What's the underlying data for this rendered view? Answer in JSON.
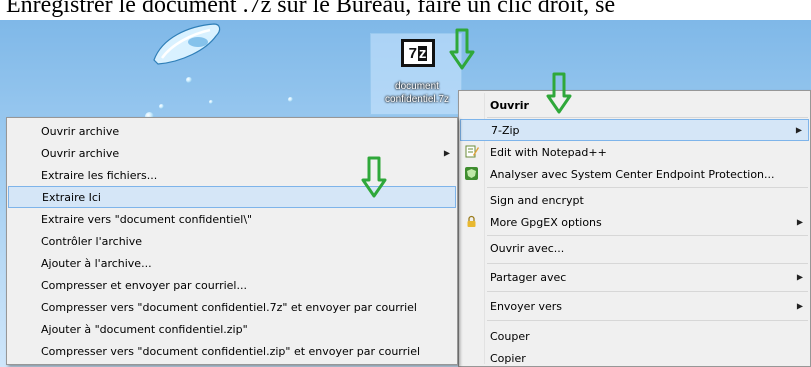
{
  "caption": "Enregistrer le document .7z sur le Bureau, faire un clic droit, sé",
  "desktop": {
    "file_icon": {
      "label": "document confidentiel.7z",
      "badge": "7z"
    }
  },
  "context_menu": {
    "items": [
      {
        "label": "Ouvrir",
        "bold": true
      },
      {
        "label": "7-Zip",
        "submenu": true,
        "highlighted": true
      },
      {
        "label": "Edit with Notepad++",
        "icon": "notepad-plus-plus-icon"
      },
      {
        "label": "Analyser avec System Center Endpoint Protection...",
        "icon": "endpoint-protection-icon"
      },
      {
        "label": "Sign and encrypt"
      },
      {
        "label": "More GpgEX options",
        "submenu": true,
        "icon": "lock-icon"
      },
      {
        "label": "Ouvrir avec..."
      },
      {
        "label": "Partager avec",
        "submenu": true
      },
      {
        "label": "Envoyer vers",
        "submenu": true
      },
      {
        "label": "Couper"
      },
      {
        "label": "Copier"
      }
    ]
  },
  "sevenzip_submenu": {
    "items": [
      {
        "label": "Ouvrir archive"
      },
      {
        "label": "Ouvrir archive",
        "submenu": true
      },
      {
        "label": "Extraire les fichiers..."
      },
      {
        "label": "Extraire Ici",
        "highlighted": true
      },
      {
        "label": "Extraire vers \"document confidentiel\\\""
      },
      {
        "label": "Contrôler l'archive"
      },
      {
        "label": "Ajouter à l'archive..."
      },
      {
        "label": "Compresser et envoyer par courriel..."
      },
      {
        "label": "Compresser vers \"document confidentiel.7z\" et envoyer par courriel"
      },
      {
        "label": "Ajouter à \"document confidentiel.zip\""
      },
      {
        "label": "Compresser vers \"document confidentiel.zip\" et envoyer par courriel"
      }
    ]
  },
  "colors": {
    "highlight": "#d5e6f7",
    "highlight_border": "#7eb4ea",
    "annotation_arrow": "#2fa83a",
    "menu_bg": "#f0f0f0"
  }
}
